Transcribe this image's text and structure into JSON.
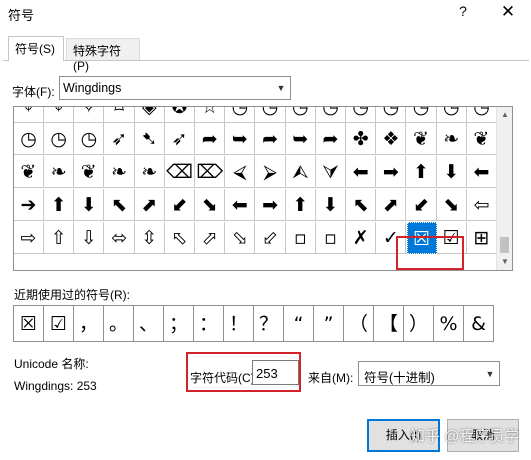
{
  "window": {
    "title": "符号",
    "help_glyph": "?",
    "close_glyph": "✕"
  },
  "tabs": [
    {
      "label": "符号(S)",
      "active": true
    },
    {
      "label": "特殊字符(P)",
      "active": false
    }
  ],
  "font": {
    "label": "字体(F):",
    "value": "Wingdings",
    "arrow_icon": "chevron-down"
  },
  "grid": {
    "rows": [
      [
        "⌖",
        "⌖",
        "✧",
        "⌑",
        "◈",
        "✪",
        "☆",
        "◷",
        "◷",
        "◷",
        "◷",
        "◷",
        "◷",
        "◷",
        "◷",
        "◷"
      ],
      [
        "◷",
        "◷",
        "◷",
        "➶",
        "➷",
        "➶",
        "➦",
        "➥",
        "➦",
        "➥",
        "➦",
        "✤",
        "❖",
        "❦",
        "❧",
        "❦"
      ],
      [
        "❦",
        "❧",
        "❦",
        "❧",
        "❧",
        "⌫",
        "⌦",
        "⮘",
        "⮚",
        "⮙",
        "⮛",
        "⬅",
        "➡",
        "⬆",
        "⬇",
        "⬅"
      ],
      [
        "➔",
        "⬆",
        "⬇",
        "⬉",
        "⬈",
        "⬋",
        "⬊",
        "⬅",
        "➡",
        "⬆",
        "⬇",
        "⬉",
        "⬈",
        "⬋",
        "⬊",
        "⇦"
      ],
      [
        "⇨",
        "⇧",
        "⇩",
        "⬄",
        "⇳",
        "⬁",
        "⬀",
        "⬂",
        "⬃",
        "▫",
        "▫",
        "✗",
        "✓",
        "☒",
        "☑",
        "⊞"
      ]
    ],
    "selected_index": 13
  },
  "recent": {
    "label": "近期使用过的符号(R):",
    "symbols": [
      "☒",
      "☑",
      "，",
      "。",
      "、",
      "；",
      "：",
      "！",
      "？",
      "“",
      "”",
      "（",
      "【",
      "）",
      "%",
      "&"
    ]
  },
  "unicode": {
    "name_label": "Unicode 名称:",
    "value": "Wingdings: 253"
  },
  "char_code": {
    "label": "字符代码(C):",
    "value": "253"
  },
  "from": {
    "label": "来自(M):",
    "value": "符号(十进制)",
    "arrow_icon": "chevron-down"
  },
  "buttons": {
    "insert": "插入(I)",
    "cancel": "取消"
  },
  "watermark": "知乎 @程序员学"
}
